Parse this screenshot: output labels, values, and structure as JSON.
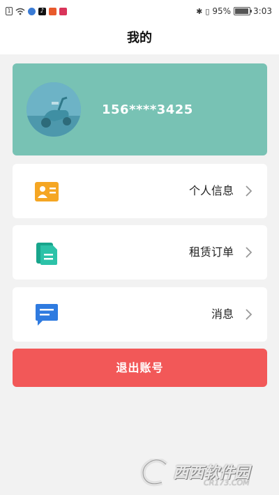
{
  "status_bar": {
    "icons": [
      "sim-icon",
      "wifi-icon",
      "app-icon-1",
      "tiktok-icon",
      "app-icon-3",
      "app-icon-4",
      "bluetooth-icon",
      "vibrate-icon"
    ],
    "battery_percent": "95%",
    "battery_level": 0.95,
    "time": "3:03"
  },
  "header": {
    "title": "我的"
  },
  "profile": {
    "phone": "156****3425"
  },
  "menu": [
    {
      "label": "个人信息",
      "icon": "id-card-icon",
      "color": "#f5a623"
    },
    {
      "label": "租赁订单",
      "icon": "document-icon",
      "color": "#1fb39a"
    },
    {
      "label": "消息",
      "icon": "message-icon",
      "color": "#2f7be0"
    }
  ],
  "logout": {
    "label": "退出账号",
    "color": "#f25858"
  },
  "watermark": {
    "main": "西西软件园",
    "sub": "CR173.COM"
  }
}
